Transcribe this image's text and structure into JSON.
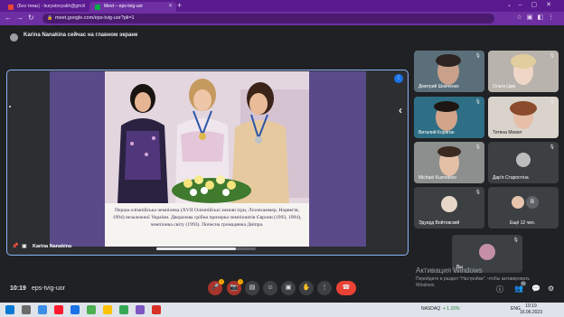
{
  "browser": {
    "tabs": [
      {
        "title": "(Без темы) - buryatovyakh@gm...",
        "favicon_color": "#ea4335"
      },
      {
        "title": "Meet – eps-tvig-uor",
        "favicon_color": "#00ac47"
      }
    ],
    "url": "meet.google.com/eps-tvig-uor?pli=1"
  },
  "meet": {
    "presenting_banner": "Karina Nanakina сейчас на главном экране",
    "presenter_name": "Karina Nanakina",
    "slide_caption": "Перша олімпійська чемпіонка (XVII Олімпійські зимові ігри, Ліллехаммер, Норвегія, 1994) незалежної України. Дворазова срібна призерка чемпіонатів Європи (1993, 1994), чемпіонка світу (1993). Почесна громадянка Дніпра.",
    "slide_progress": 0.8,
    "participants": [
      "Дмитрий Шевченко",
      "Ольга Цма",
      "Виталий Корягин",
      "Тетяна Момот",
      "Michael Kuznetsov",
      "Дар'я Старостіна",
      "Эдуард Войтовский"
    ],
    "more_tile": {
      "label": "Ещё 12 чел.",
      "initial": "B"
    },
    "self_tile": {
      "label": "Вы"
    },
    "time": "10:19",
    "meeting_code": "eps-tvig-uor",
    "badges": {
      "mic": "!",
      "cam": "!"
    },
    "people_count": "21"
  },
  "windows": {
    "activation_title": "Активация Windows",
    "activation_hint": "Перейдите в раздел \"Настройки\", чтобы активировать Windows.",
    "ticker": "NASDAQ",
    "ticker_change": "+ 1.15%",
    "language": "ENG",
    "clock_time": "10:19",
    "clock_date": "16.06.2023"
  },
  "colors": {
    "accent": "#8ab4f8",
    "hangup": "#ea4335",
    "browser_frame": "#6e2fa3"
  }
}
